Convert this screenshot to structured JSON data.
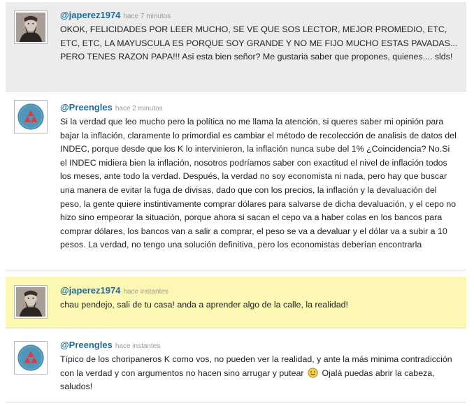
{
  "posts": [
    {
      "username": "@japerez1974",
      "time": "hace 7 minutos",
      "avatar": "bearded-man-portrait-icon",
      "text": "OKOK, FELICIDADES POR LEER MUCHO, SE VE QUE SOS LECTOR, MEJOR PROMEDIO, ETC, ETC, ETC, LA MAYUSCULA ES PORQUE SOY GRANDE Y NO ME FIJO MUCHO ESTAS PAVADAS... PERO TENES RAZON PAPA!!! Asi esta bien señor? Me gustaria saber que propones, quienes.... slds!"
    },
    {
      "username": "@Preengles",
      "time": "hace 2 minutos",
      "avatar": "triforce-badge-icon",
      "text": "Si la verdad que leo mucho pero la política no me llama la atención, si queres saber mi opinión para bajar la inflación, claramente lo primordial es cambiar el método de recolección de analisis de datos del INDEC, porque desde que los K lo intervinieron, la inflación nunca sube del 1% ¿Coincidencia? No.Si el INDEC midiera bien la inflación, nosotros podríamos saber con exactitud el nivel de inflación todos los meses, ante todo la verdad. Después, la verdad no soy economista ni nada, pero hay que buscar una manera de evitar la fuga de divisas, dado que con los precios, la inflación y la devaluación del peso, la gente quiere instintivamente comprar dólares para salvarse de dicha devaluación, y el cepo no hizo sino empeorar la situación, porque ahora si sacan el cepo va a haber colas en los bancos para comprar dólares, los bancos van a salir a comprar, el peso se va a devaluar y el dólar va a subir a 10 pesos. La verdad, no tengo una solución definitiva, pero los economistas deberían encontrarla"
    },
    {
      "username": "@japerez1974",
      "time": "hace instantes",
      "avatar": "bearded-man-portrait-icon",
      "text": "chau pendejo, sali de tu casa! anda a aprender algo de la calle, la realidad!"
    },
    {
      "username": "@Preengles",
      "time": "hace instantes",
      "avatar": "triforce-badge-icon",
      "text_before_emoticon": "Típico de los choripaneros K como vos, no pueden ver la realidad, y ante la más minima contradicción con la verdad y con argumentos no hacen sino arrugar y putear",
      "emoticon": "smiley-icon",
      "text_after_emoticon": "Ojalá puedas abrir la cabeza, saludos!"
    }
  ]
}
